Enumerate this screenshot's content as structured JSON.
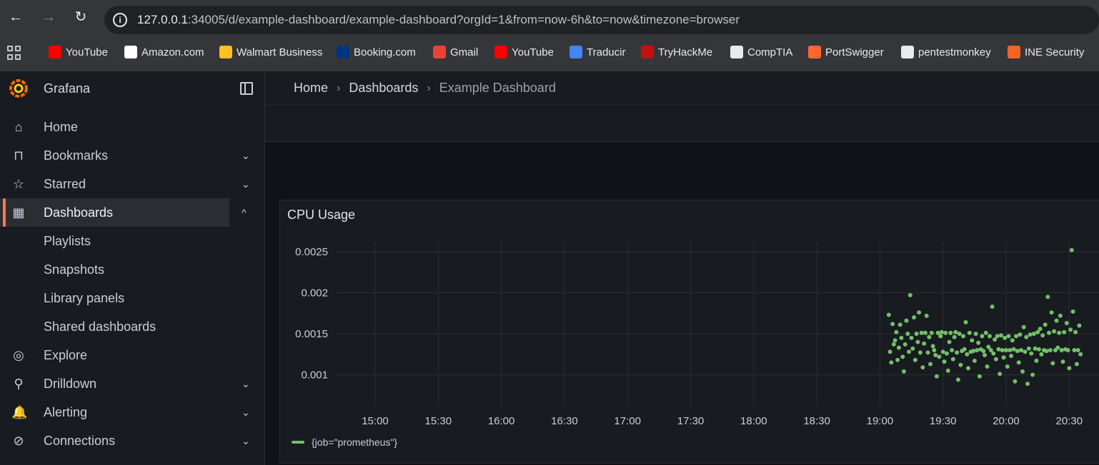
{
  "browser": {
    "url_host": "127.0.0.1",
    "url_rest": ":34005/d/example-dashboard/example-dashboard?orgId=1&from=now-6h&to=now&timezone=browser",
    "bookmarks": [
      {
        "label": "YouTube",
        "icon": "youtube-icon",
        "color": "#ff0000"
      },
      {
        "label": "Amazon.com",
        "icon": "amazon-icon",
        "color": "#ffffff"
      },
      {
        "label": "Walmart Business",
        "icon": "walmart-icon",
        "color": "#ffc220"
      },
      {
        "label": "Booking.com",
        "icon": "booking-icon",
        "color": "#003580"
      },
      {
        "label": "Gmail",
        "icon": "gmail-icon",
        "color": "#ea4335"
      },
      {
        "label": "YouTube",
        "icon": "youtube-icon",
        "color": "#ff0000"
      },
      {
        "label": "Traducir",
        "icon": "translate-icon",
        "color": "#4285f4"
      },
      {
        "label": "TryHackMe",
        "icon": "tryhackme-icon",
        "color": "#c11111"
      },
      {
        "label": "CompTIA",
        "icon": "globe-icon",
        "color": "#e8eaed"
      },
      {
        "label": "PortSwigger",
        "icon": "portswigger-icon",
        "color": "#ff6633"
      },
      {
        "label": "pentestmonkey",
        "icon": "globe-icon",
        "color": "#e8eaed"
      },
      {
        "label": "INE Security",
        "icon": "ine-icon",
        "color": "#f26522"
      }
    ]
  },
  "app": {
    "brand": "Grafana",
    "accent": "#ff7a45"
  },
  "sidebar": {
    "items": [
      {
        "label": "Home",
        "icon": "home-icon",
        "chevron": ""
      },
      {
        "label": "Bookmarks",
        "icon": "bookmark-icon",
        "chevron": "⌄"
      },
      {
        "label": "Starred",
        "icon": "star-icon",
        "chevron": "⌄"
      },
      {
        "label": "Dashboards",
        "icon": "apps-icon",
        "chevron": "^"
      },
      {
        "label": "Playlists",
        "icon": "",
        "chevron": ""
      },
      {
        "label": "Snapshots",
        "icon": "",
        "chevron": ""
      },
      {
        "label": "Library panels",
        "icon": "",
        "chevron": ""
      },
      {
        "label": "Shared dashboards",
        "icon": "",
        "chevron": ""
      },
      {
        "label": "Explore",
        "icon": "compass-icon",
        "chevron": ""
      },
      {
        "label": "Drilldown",
        "icon": "drilldown-icon",
        "chevron": "⌄"
      },
      {
        "label": "Alerting",
        "icon": "bell-icon",
        "chevron": "⌄"
      },
      {
        "label": "Connections",
        "icon": "connections-icon",
        "chevron": "⌄"
      }
    ]
  },
  "breadcrumb": {
    "home": "Home",
    "dashboards": "Dashboards",
    "current": "Example Dashboard"
  },
  "panel": {
    "title": "CPU Usage"
  },
  "chart_data": {
    "type": "scatter",
    "title": "CPU Usage",
    "x_ticks": [
      "15:00",
      "15:30",
      "16:00",
      "16:30",
      "17:00",
      "17:30",
      "18:00",
      "18:30",
      "19:00",
      "19:30",
      "20:00",
      "20:30"
    ],
    "y_ticks": [
      "0.0025",
      "0.002",
      "0.0015",
      "0.001"
    ],
    "ylim": [
      0.00083,
      0.0027
    ],
    "grid": true,
    "legend": "bottom-left",
    "series": [
      {
        "name": "{job=\"prometheus\"}",
        "color": "#73bf69",
        "note_x_range": "19:05-20:35",
        "points": [
          [
            19.07,
            0.00173
          ],
          [
            19.08,
            0.00128
          ],
          [
            19.09,
            0.00115
          ],
          [
            19.1,
            0.00162
          ],
          [
            19.11,
            0.00137
          ],
          [
            19.12,
            0.00142
          ],
          [
            19.13,
            0.00152
          ],
          [
            19.14,
            0.00118
          ],
          [
            19.15,
            0.00133
          ],
          [
            19.16,
            0.00161
          ],
          [
            19.17,
            0.00145
          ],
          [
            19.18,
            0.00122
          ],
          [
            19.19,
            0.00104
          ],
          [
            19.2,
            0.00137
          ],
          [
            19.21,
            0.00166
          ],
          [
            19.22,
            0.0015
          ],
          [
            19.23,
            0.00128
          ],
          [
            19.24,
            0.00197
          ],
          [
            19.25,
            0.00145
          ],
          [
            19.26,
            0.00132
          ],
          [
            19.27,
            0.0017
          ],
          [
            19.28,
            0.00118
          ],
          [
            19.29,
            0.0015
          ],
          [
            19.3,
            0.0014
          ],
          [
            19.31,
            0.00176
          ],
          [
            19.32,
            0.00127
          ],
          [
            19.33,
            0.00151
          ],
          [
            19.34,
            0.00109
          ],
          [
            19.35,
            0.00138
          ],
          [
            19.36,
            0.00151
          ],
          [
            19.37,
            0.00172
          ],
          [
            19.38,
            0.00127
          ],
          [
            19.39,
            0.00146
          ],
          [
            19.4,
            0.00113
          ],
          [
            19.41,
            0.00151
          ],
          [
            19.42,
            0.00135
          ],
          [
            19.43,
            0.0013
          ],
          [
            19.44,
            0.00124
          ],
          [
            19.45,
            0.00098
          ],
          [
            19.46,
            0.00151
          ],
          [
            19.47,
            0.00122
          ],
          [
            19.48,
            0.00147
          ],
          [
            19.49,
            0.00152
          ],
          [
            19.5,
            0.00128
          ],
          [
            19.51,
            0.00116
          ],
          [
            19.52,
            0.00151
          ],
          [
            19.53,
            0.00126
          ],
          [
            19.54,
            0.00105
          ],
          [
            19.55,
            0.0014
          ],
          [
            19.56,
            0.00151
          ],
          [
            19.57,
            0.0013
          ],
          [
            19.58,
            0.00119
          ],
          [
            19.59,
            0.00146
          ],
          [
            19.6,
            0.00152
          ],
          [
            19.61,
            0.00127
          ],
          [
            19.62,
            0.00094
          ],
          [
            19.63,
            0.0015
          ],
          [
            19.64,
            0.00112
          ],
          [
            19.65,
            0.00129
          ],
          [
            19.66,
            0.00147
          ],
          [
            19.67,
            0.00131
          ],
          [
            19.68,
            0.00164
          ],
          [
            19.69,
            0.00125
          ],
          [
            19.7,
            0.00108
          ],
          [
            19.71,
            0.00151
          ],
          [
            19.72,
            0.00128
          ],
          [
            19.73,
            0.00142
          ],
          [
            19.74,
            0.00129
          ],
          [
            19.75,
            0.00117
          ],
          [
            19.76,
            0.0015
          ],
          [
            19.77,
            0.0013
          ],
          [
            19.78,
            0.00139
          ],
          [
            19.79,
            0.00098
          ],
          [
            19.8,
            0.00131
          ],
          [
            19.81,
            0.00147
          ],
          [
            19.82,
            0.00129
          ],
          [
            19.83,
            0.00124
          ],
          [
            19.84,
            0.00151
          ],
          [
            19.85,
            0.0011
          ],
          [
            19.86,
            0.00134
          ],
          [
            19.87,
            0.00147
          ],
          [
            19.88,
            0.0013
          ],
          [
            19.89,
            0.00183
          ],
          [
            19.9,
            0.00126
          ],
          [
            19.91,
            0.00143
          ],
          [
            19.92,
            0.00119
          ],
          [
            19.93,
            0.00147
          ],
          [
            19.94,
            0.00131
          ],
          [
            19.95,
            0.00101
          ],
          [
            19.96,
            0.00148
          ],
          [
            19.97,
            0.0013
          ],
          [
            19.98,
            0.00121
          ],
          [
            19.99,
            0.00145
          ],
          [
            20.0,
            0.0013
          ],
          [
            20.01,
            0.0011
          ],
          [
            20.02,
            0.00147
          ],
          [
            20.03,
            0.0013
          ],
          [
            20.04,
            0.00123
          ],
          [
            20.05,
            0.00142
          ],
          [
            20.06,
            0.00131
          ],
          [
            20.07,
            0.00092
          ],
          [
            20.08,
            0.00147
          ],
          [
            20.09,
            0.00129
          ],
          [
            20.1,
            0.00115
          ],
          [
            20.11,
            0.00149
          ],
          [
            20.12,
            0.0013
          ],
          [
            20.13,
            0.00104
          ],
          [
            20.14,
            0.00158
          ],
          [
            20.15,
            0.00128
          ],
          [
            20.16,
            0.00146
          ],
          [
            20.17,
            0.00089
          ],
          [
            20.18,
            0.00132
          ],
          [
            20.19,
            0.00149
          ],
          [
            20.2,
            0.00126
          ],
          [
            20.21,
            0.001
          ],
          [
            20.22,
            0.0015
          ],
          [
            20.23,
            0.00132
          ],
          [
            20.24,
            0.00117
          ],
          [
            20.25,
            0.00152
          ],
          [
            20.26,
            0.00131
          ],
          [
            20.27,
            0.00156
          ],
          [
            20.28,
            0.00125
          ],
          [
            20.29,
            0.00148
          ],
          [
            20.3,
            0.0013
          ],
          [
            20.31,
            0.00161
          ],
          [
            20.32,
            0.00129
          ],
          [
            20.33,
            0.00195
          ],
          [
            20.34,
            0.00151
          ],
          [
            20.35,
            0.0013
          ],
          [
            20.36,
            0.00176
          ],
          [
            20.37,
            0.00114
          ],
          [
            20.38,
            0.00153
          ],
          [
            20.39,
            0.0013
          ],
          [
            20.4,
            0.00166
          ],
          [
            20.41,
            0.00133
          ],
          [
            20.42,
            0.00151
          ],
          [
            20.43,
            0.00172
          ],
          [
            20.44,
            0.0013
          ],
          [
            20.45,
            0.00116
          ],
          [
            20.46,
            0.00152
          ],
          [
            20.47,
            0.00131
          ],
          [
            20.48,
            0.00163
          ],
          [
            20.49,
            0.0013
          ],
          [
            20.5,
            0.00108
          ],
          [
            20.51,
            0.00155
          ],
          [
            20.52,
            0.00252
          ],
          [
            20.53,
            0.00177
          ],
          [
            20.54,
            0.0013
          ],
          [
            20.55,
            0.00152
          ],
          [
            20.56,
            0.00113
          ],
          [
            20.57,
            0.0013
          ],
          [
            20.58,
            0.0016
          ],
          [
            20.59,
            0.00125
          ]
        ]
      }
    ]
  }
}
